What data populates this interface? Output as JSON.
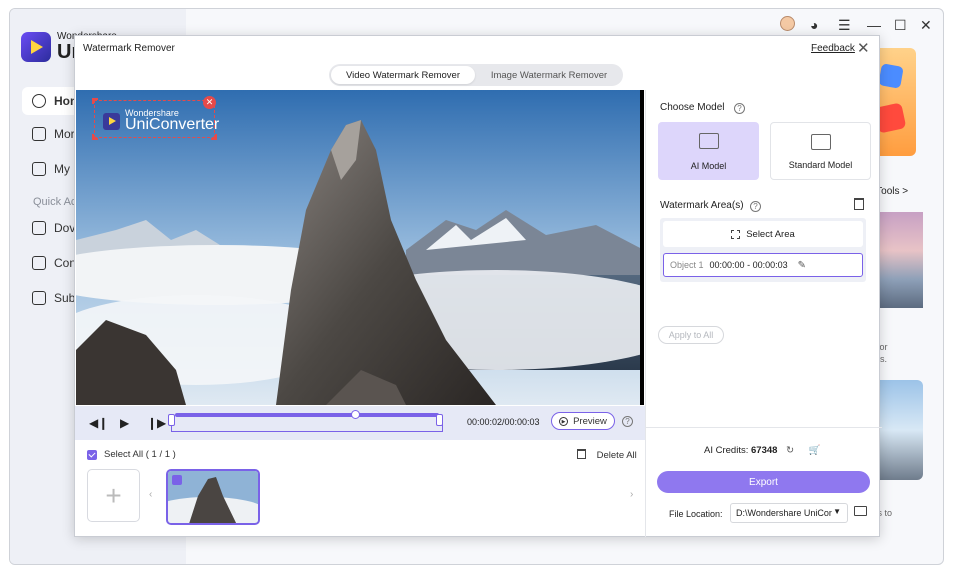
{
  "app": {
    "brand_small": "Wondershare",
    "brand_big": "Un",
    "nav": [
      {
        "label": "Hon",
        "icon": "home-icon",
        "active": true
      },
      {
        "label": "Mor",
        "icon": "toolbox-icon",
        "active": false
      },
      {
        "label": "My",
        "icon": "file-icon",
        "active": false
      }
    ],
    "quick_label": "Quick Ac",
    "quick_nav": [
      {
        "label": "Dov",
        "icon": "download-icon"
      },
      {
        "label": "Con",
        "icon": "convert-icon"
      },
      {
        "label": "Sub",
        "icon": "subtitle-icon"
      }
    ],
    "tools_link": "e Tools >",
    "card_text_1a": "s for",
    "card_text_1b": "ons.",
    "card_text_2": "ats to"
  },
  "modal": {
    "title": "Watermark Remover",
    "feedback": "Feedback",
    "tabs": [
      {
        "label": "Video Watermark Remover",
        "selected": true
      },
      {
        "label": "Image Watermark Remover",
        "selected": false
      }
    ],
    "watermark": {
      "brand_small": "Wondershare",
      "brand_big": "UniConverter"
    },
    "timecode": "00:00:02/00:00:03",
    "preview": "Preview",
    "progress": 0.68,
    "select_all": "Select All ( 1 / 1 )",
    "delete_all": "Delete All",
    "right_panel": {
      "choose_model": "Choose Model",
      "models": [
        {
          "label": "AI Model",
          "selected": true
        },
        {
          "label": "Standard Model",
          "selected": false
        }
      ],
      "watermark_area": "Watermark Area(s)",
      "select_area": "Select Area",
      "object_label": "Object 1",
      "object_time": "00:00:00 - 00:00:03",
      "apply_all": "Apply to All",
      "credits_label": "AI Credits:",
      "credits_value": "67348",
      "export": "Export",
      "file_location_label": "File Location:",
      "file_location_value": "D:\\Wondershare UniCor"
    }
  },
  "colors": {
    "accent": "#7a62e8",
    "export": "#8f78ef",
    "ai_card": "#ddd6fb",
    "watermark_border": "#e64a4a"
  }
}
